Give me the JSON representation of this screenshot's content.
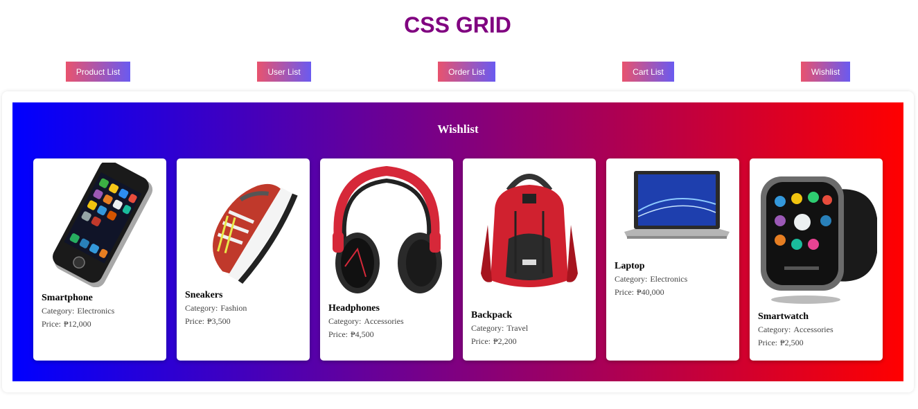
{
  "page": {
    "title": "CSS GRID"
  },
  "nav": {
    "items": [
      {
        "label": "Product List"
      },
      {
        "label": "User List"
      },
      {
        "label": "Order List"
      },
      {
        "label": "Cart List"
      },
      {
        "label": "Wishlist"
      }
    ]
  },
  "wishlist": {
    "title": "Wishlist",
    "category_prefix": "Category:",
    "price_prefix": "Price:",
    "products": [
      {
        "name": "Smartphone",
        "category": "Electronics",
        "price": "₱12,000"
      },
      {
        "name": "Sneakers",
        "category": "Fashion",
        "price": "₱3,500"
      },
      {
        "name": "Headphones",
        "category": "Accessories",
        "price": "₱4,500"
      },
      {
        "name": "Backpack",
        "category": "Travel",
        "price": "₱2,200"
      },
      {
        "name": "Laptop",
        "category": "Electronics",
        "price": "₱40,000"
      },
      {
        "name": "Smartwatch",
        "category": "Accessories",
        "price": "₱2,500"
      }
    ]
  },
  "colors": {
    "title": "#800080",
    "nav_gradient_start": "#e8536e",
    "nav_gradient_end": "#6a5af0",
    "panel_gradient": [
      "#0000ff",
      "#800080",
      "#ff0000"
    ]
  },
  "icons": [
    "smartphone-image",
    "sneakers-image",
    "headphones-image",
    "backpack-image",
    "laptop-image",
    "smartwatch-image"
  ]
}
